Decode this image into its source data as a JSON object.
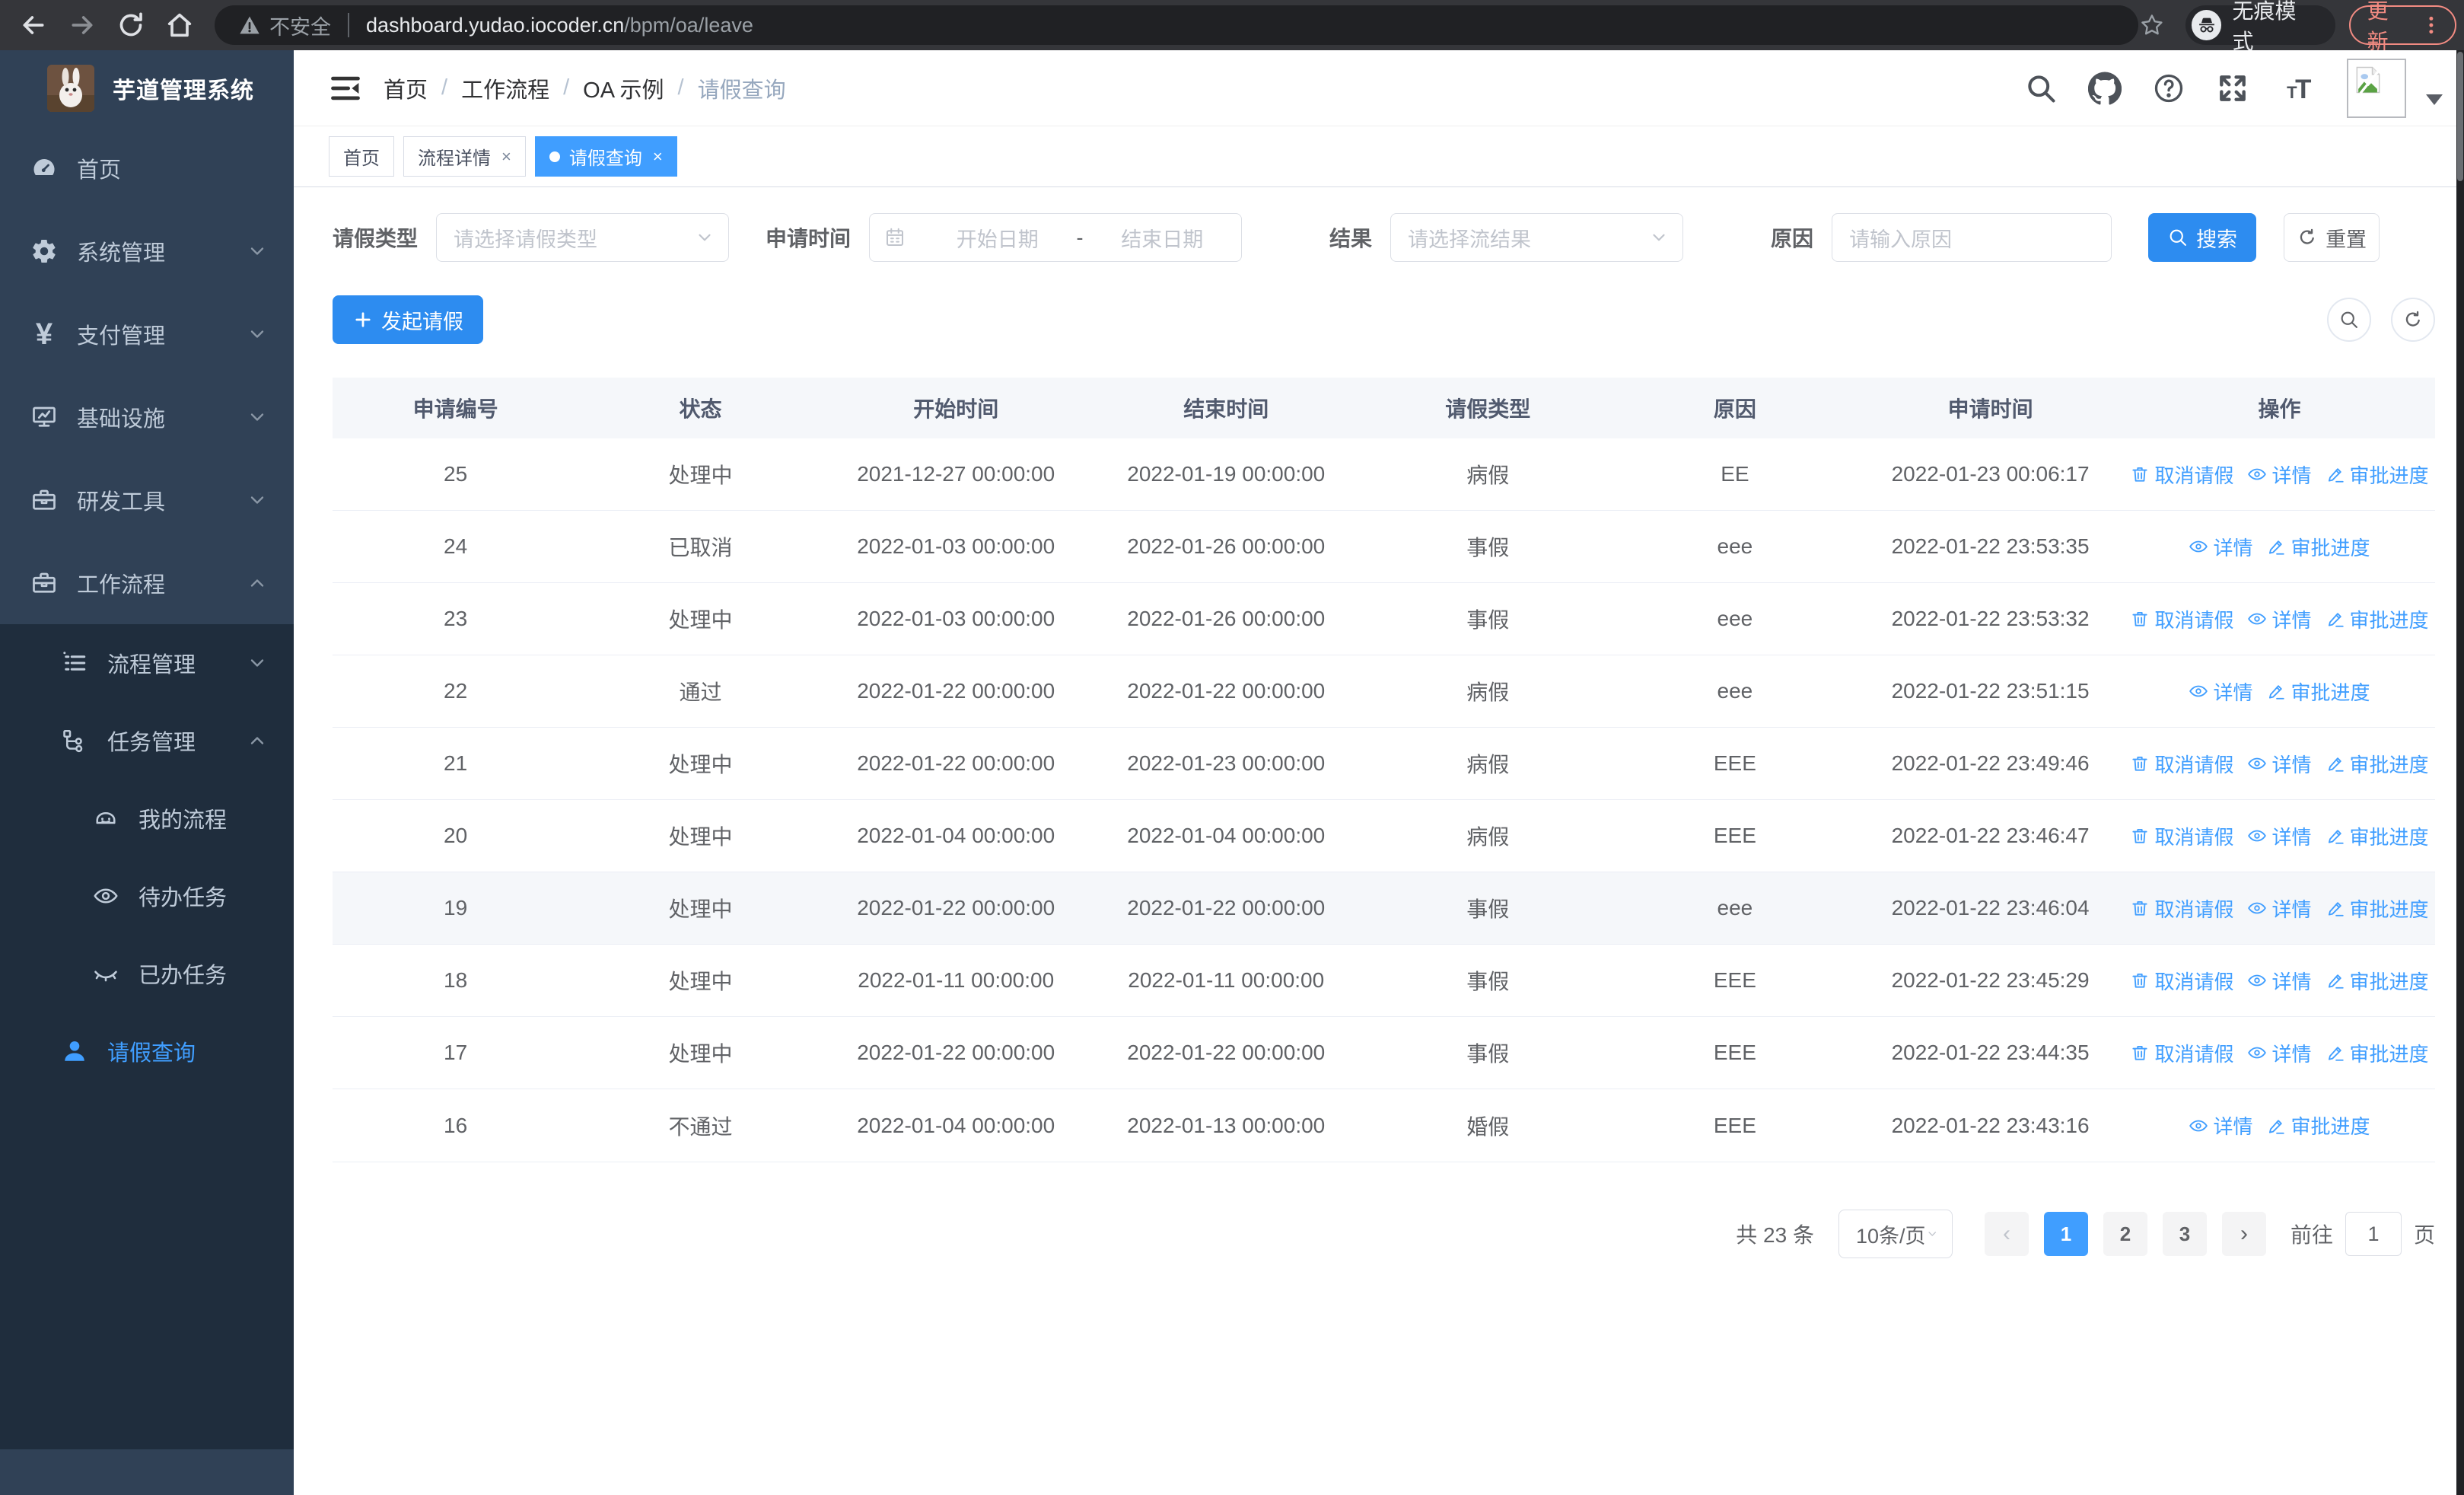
{
  "browser": {
    "security_label": "不安全",
    "url_host": "dashboard.yudao.iocoder.cn",
    "url_path": "/bpm/oa/leave",
    "incognito_label": "无痕模式",
    "update_label": "更新",
    "nav_icons": [
      "back-icon",
      "forward-icon",
      "reload-icon",
      "home-icon"
    ]
  },
  "sidebar": {
    "app_title": "芋道管理系统",
    "items": [
      {
        "label": "首页",
        "icon": "dashboard-icon",
        "level": 1,
        "sub": false,
        "chevron": null,
        "active": false
      },
      {
        "label": "系统管理",
        "icon": "gear-icon",
        "level": 1,
        "sub": false,
        "chevron": "down",
        "active": false
      },
      {
        "label": "支付管理",
        "icon": "yen-icon",
        "level": 1,
        "sub": false,
        "chevron": "down",
        "active": false
      },
      {
        "label": "基础设施",
        "icon": "monitor-icon",
        "level": 1,
        "sub": false,
        "chevron": "down",
        "active": false
      },
      {
        "label": "研发工具",
        "icon": "toolbox-icon",
        "level": 1,
        "sub": false,
        "chevron": "down",
        "active": false
      },
      {
        "label": "工作流程",
        "icon": "briefcase-icon",
        "level": 1,
        "sub": false,
        "chevron": "up",
        "active": false
      },
      {
        "label": "流程管理",
        "icon": "list-tree-icon",
        "level": 2,
        "sub": true,
        "chevron": "down",
        "active": false
      },
      {
        "label": "任务管理",
        "icon": "flow-tree-icon",
        "level": 2,
        "sub": true,
        "chevron": "up",
        "active": false
      },
      {
        "label": "我的流程",
        "icon": "robot-icon",
        "level": 3,
        "sub": true,
        "chevron": null,
        "active": false
      },
      {
        "label": "待办任务",
        "icon": "eye-open-icon",
        "level": 3,
        "sub": true,
        "chevron": null,
        "active": false
      },
      {
        "label": "已办任务",
        "icon": "eye-closed-icon",
        "level": 3,
        "sub": true,
        "chevron": null,
        "active": false
      },
      {
        "label": "请假查询",
        "icon": "user-icon",
        "level": 2,
        "sub": true,
        "chevron": null,
        "active": true
      }
    ]
  },
  "header": {
    "breadcrumb": [
      "首页",
      "工作流程",
      "OA 示例",
      "请假查询"
    ],
    "breadcrumb_separator": "/",
    "action_icons": [
      "search-icon",
      "github-icon",
      "help-icon",
      "fullscreen-icon",
      "font-size-icon"
    ],
    "tabs": [
      {
        "label": "首页",
        "active": false,
        "closable": false
      },
      {
        "label": "流程详情",
        "active": false,
        "closable": true
      },
      {
        "label": "请假查询",
        "active": true,
        "closable": true
      }
    ],
    "tab_close_glyph": "×"
  },
  "filters": {
    "leave_type_label": "请假类型",
    "leave_type_placeholder": "请选择请假类型",
    "apply_time_label": "申请时间",
    "start_date_placeholder": "开始日期",
    "date_separator": "-",
    "end_date_placeholder": "结束日期",
    "result_label": "结果",
    "result_placeholder": "请选择流结果",
    "reason_label": "原因",
    "reason_placeholder": "请输入原因",
    "search_label": "搜索",
    "search_icon": "search-icon",
    "reset_label": "重置",
    "reset_icon": "refresh-icon"
  },
  "toolbar": {
    "create_label": "发起请假",
    "create_icon": "plus-icon",
    "tool_icons": [
      "circle-search-icon",
      "circle-refresh-icon"
    ]
  },
  "table": {
    "columns": [
      "申请编号",
      "状态",
      "开始时间",
      "结束时间",
      "请假类型",
      "原因",
      "申请时间",
      "操作"
    ],
    "action_defs": {
      "cancel": {
        "label": "取消请假",
        "icon": "trash-icon"
      },
      "detail": {
        "label": "详情",
        "icon": "view-icon"
      },
      "progress": {
        "label": "审批进度",
        "icon": "pen-icon"
      }
    },
    "rows": [
      {
        "id": "25",
        "status": "处理中",
        "start": "2021-12-27 00:00:00",
        "end": "2022-01-19 00:00:00",
        "type": "病假",
        "reason": "EE",
        "applied": "2022-01-23 00:06:17",
        "actions": [
          "cancel",
          "detail",
          "progress"
        ],
        "hover": false
      },
      {
        "id": "24",
        "status": "已取消",
        "start": "2022-01-03 00:00:00",
        "end": "2022-01-26 00:00:00",
        "type": "事假",
        "reason": "eee",
        "applied": "2022-01-22 23:53:35",
        "actions": [
          "detail",
          "progress"
        ],
        "hover": false
      },
      {
        "id": "23",
        "status": "处理中",
        "start": "2022-01-03 00:00:00",
        "end": "2022-01-26 00:00:00",
        "type": "事假",
        "reason": "eee",
        "applied": "2022-01-22 23:53:32",
        "actions": [
          "cancel",
          "detail",
          "progress"
        ],
        "hover": false
      },
      {
        "id": "22",
        "status": "通过",
        "start": "2022-01-22 00:00:00",
        "end": "2022-01-22 00:00:00",
        "type": "病假",
        "reason": "eee",
        "applied": "2022-01-22 23:51:15",
        "actions": [
          "detail",
          "progress"
        ],
        "hover": false
      },
      {
        "id": "21",
        "status": "处理中",
        "start": "2022-01-22 00:00:00",
        "end": "2022-01-23 00:00:00",
        "type": "病假",
        "reason": "EEE",
        "applied": "2022-01-22 23:49:46",
        "actions": [
          "cancel",
          "detail",
          "progress"
        ],
        "hover": false
      },
      {
        "id": "20",
        "status": "处理中",
        "start": "2022-01-04 00:00:00",
        "end": "2022-01-04 00:00:00",
        "type": "病假",
        "reason": "EEE",
        "applied": "2022-01-22 23:46:47",
        "actions": [
          "cancel",
          "detail",
          "progress"
        ],
        "hover": false
      },
      {
        "id": "19",
        "status": "处理中",
        "start": "2022-01-22 00:00:00",
        "end": "2022-01-22 00:00:00",
        "type": "事假",
        "reason": "eee",
        "applied": "2022-01-22 23:46:04",
        "actions": [
          "cancel",
          "detail",
          "progress"
        ],
        "hover": true
      },
      {
        "id": "18",
        "status": "处理中",
        "start": "2022-01-11 00:00:00",
        "end": "2022-01-11 00:00:00",
        "type": "事假",
        "reason": "EEE",
        "applied": "2022-01-22 23:45:29",
        "actions": [
          "cancel",
          "detail",
          "progress"
        ],
        "hover": false
      },
      {
        "id": "17",
        "status": "处理中",
        "start": "2022-01-22 00:00:00",
        "end": "2022-01-22 00:00:00",
        "type": "事假",
        "reason": "EEE",
        "applied": "2022-01-22 23:44:35",
        "actions": [
          "cancel",
          "detail",
          "progress"
        ],
        "hover": false
      },
      {
        "id": "16",
        "status": "不通过",
        "start": "2022-01-04 00:00:00",
        "end": "2022-01-13 00:00:00",
        "type": "婚假",
        "reason": "EEE",
        "applied": "2022-01-22 23:43:16",
        "actions": [
          "detail",
          "progress"
        ],
        "hover": false
      }
    ]
  },
  "pagination": {
    "total_label": "共 23 条",
    "page_size_label": "10条/页",
    "prev_glyph": "‹",
    "next_glyph": "›",
    "pages": [
      {
        "label": "1",
        "active": true
      },
      {
        "label": "2",
        "active": false
      },
      {
        "label": "3",
        "active": false
      }
    ],
    "goto_label": "前往",
    "goto_value": "1",
    "goto_unit": "页"
  }
}
